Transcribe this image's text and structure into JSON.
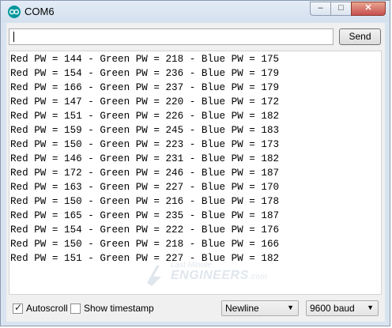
{
  "window": {
    "title": "COM6",
    "icon": "arduino-logo-icon",
    "controls": {
      "minimize": "–",
      "maximize": "□",
      "close": "✕"
    }
  },
  "input": {
    "value": ""
  },
  "send_label": "Send",
  "output": {
    "lines": [
      "Red PW = 144 - Green PW = 218 - Blue PW = 175",
      "Red PW = 154 - Green PW = 236 - Blue PW = 179",
      "Red PW = 166 - Green PW = 237 - Blue PW = 179",
      "Red PW = 147 - Green PW = 220 - Blue PW = 172",
      "Red PW = 151 - Green PW = 226 - Blue PW = 182",
      "Red PW = 159 - Green PW = 245 - Blue PW = 183",
      "Red PW = 150 - Green PW = 223 - Blue PW = 173",
      "Red PW = 146 - Green PW = 231 - Blue PW = 182",
      "Red PW = 172 - Green PW = 246 - Blue PW = 187",
      "Red PW = 163 - Green PW = 227 - Blue PW = 170",
      "Red PW = 150 - Green PW = 216 - Blue PW = 178",
      "Red PW = 165 - Green PW = 235 - Blue PW = 187",
      "Red PW = 154 - Green PW = 222 - Blue PW = 176",
      "Red PW = 150 - Green PW = 218 - Blue PW = 166",
      "Red PW = 151 - Green PW = 227 - Blue PW = 182"
    ]
  },
  "watermark": {
    "line1": "Last Minute",
    "line2": "ENGINEERS",
    "line3": ".com"
  },
  "footer": {
    "autoscroll": {
      "label": "Autoscroll",
      "checked": true
    },
    "timestamp": {
      "label": "Show timestamp",
      "checked": false
    },
    "line_ending": "Newline",
    "baud": "9600 baud"
  },
  "colors": {
    "arduino_teal": "#00979c",
    "close_red": "#c75050"
  }
}
